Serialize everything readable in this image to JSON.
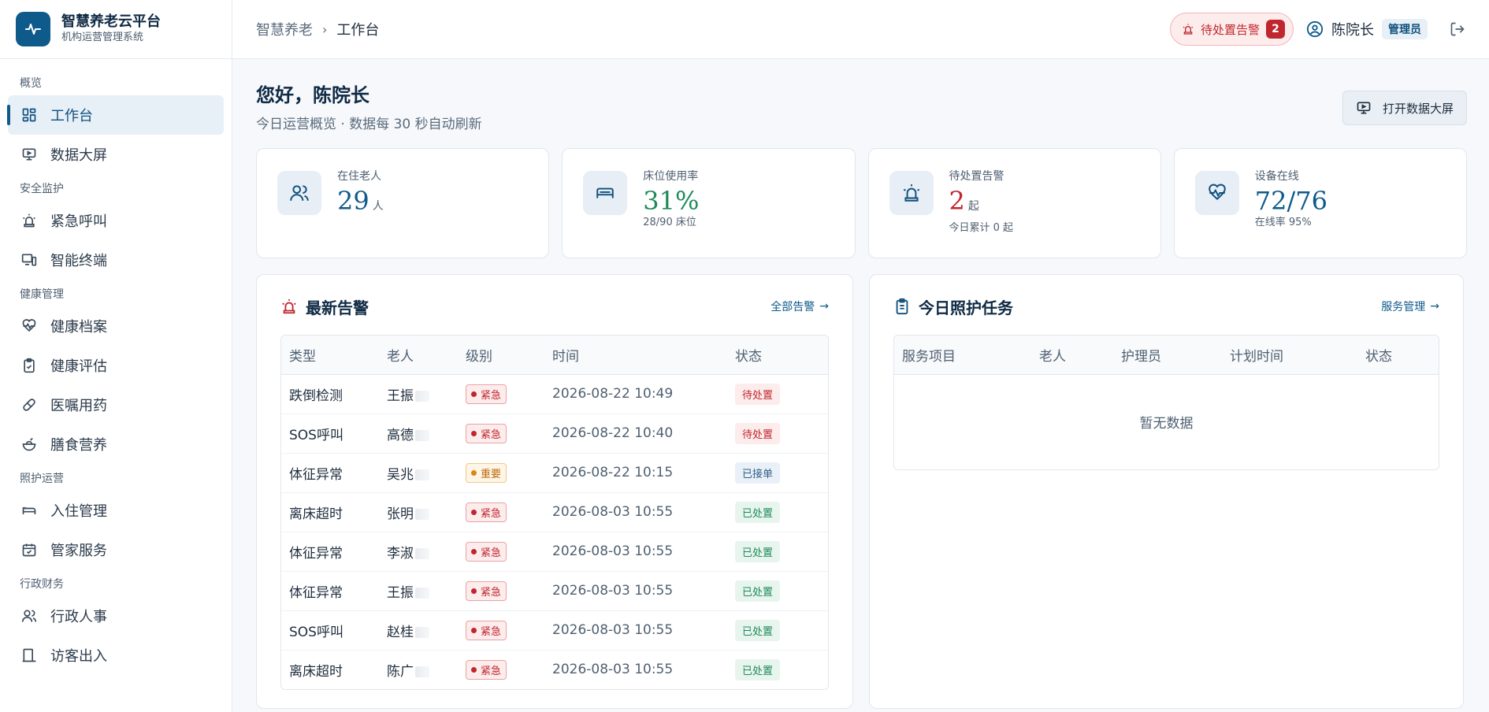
{
  "brand": {
    "title": "智慧养老云平台",
    "subtitle": "机构运营管理系统"
  },
  "sidebar": {
    "groups": [
      {
        "label": "概览",
        "items": [
          {
            "label": "工作台",
            "icon": "dashboard-icon",
            "active": true
          },
          {
            "label": "数据大屏",
            "icon": "monitor-icon"
          }
        ]
      },
      {
        "label": "安全监护",
        "items": [
          {
            "label": "紧急呼叫",
            "icon": "siren-icon"
          },
          {
            "label": "智能终端",
            "icon": "devices-icon"
          }
        ]
      },
      {
        "label": "健康管理",
        "items": [
          {
            "label": "健康档案",
            "icon": "heart-pulse-icon"
          },
          {
            "label": "健康评估",
            "icon": "clipboard-check-icon"
          },
          {
            "label": "医嘱用药",
            "icon": "pill-icon"
          },
          {
            "label": "膳食营养",
            "icon": "salad-icon"
          }
        ]
      },
      {
        "label": "照护运营",
        "items": [
          {
            "label": "入住管理",
            "icon": "bed-icon"
          },
          {
            "label": "管家服务",
            "icon": "calendar-check-icon"
          }
        ]
      },
      {
        "label": "行政财务",
        "items": [
          {
            "label": "行政人事",
            "icon": "users-icon"
          },
          {
            "label": "访客出入",
            "icon": "door-icon"
          }
        ]
      }
    ]
  },
  "header": {
    "breadcrumb": [
      "智慧养老",
      "工作台"
    ],
    "alarm_label": "待处置告警",
    "alarm_count": "2",
    "user_name": "陈院长",
    "user_role": "管理员"
  },
  "welcome": {
    "title": "您好，陈院长",
    "subtitle": "今日运营概览 · 数据每 30 秒自动刷新",
    "open_screen": "打开数据大屏"
  },
  "stats": [
    {
      "label": "在住老人",
      "value": "29",
      "unit": "人",
      "sub": "",
      "icon": "users-icon"
    },
    {
      "label": "床位使用率",
      "value": "31%",
      "unit": "",
      "sub": "28/90 床位",
      "icon": "bed-icon"
    },
    {
      "label": "待处置告警",
      "value": "2",
      "unit": "起",
      "sub": "今日累计 0 起",
      "icon": "siren-icon"
    },
    {
      "label": "设备在线",
      "value": "72/76",
      "unit": "",
      "sub": "在线率 95%",
      "icon": "heart-pulse-icon"
    }
  ],
  "alerts": {
    "title": "最新告警",
    "more": "全部告警",
    "columns": [
      "类型",
      "老人",
      "级别",
      "时间",
      "状态"
    ],
    "rows": [
      {
        "type": "跌倒检测",
        "elder": "王振",
        "level": "紧急",
        "time": "2026-08-22 10:49",
        "status": "待处置"
      },
      {
        "type": "SOS呼叫",
        "elder": "高德",
        "level": "紧急",
        "time": "2026-08-22 10:40",
        "status": "待处置"
      },
      {
        "type": "体征异常",
        "elder": "吴兆",
        "level": "重要",
        "time": "2026-08-22 10:15",
        "status": "已接单"
      },
      {
        "type": "离床超时",
        "elder": "张明",
        "level": "紧急",
        "time": "2026-08-03 10:55",
        "status": "已处置"
      },
      {
        "type": "体征异常",
        "elder": "李淑",
        "level": "紧急",
        "time": "2026-08-03 10:55",
        "status": "已处置"
      },
      {
        "type": "体征异常",
        "elder": "王振",
        "level": "紧急",
        "time": "2026-08-03 10:55",
        "status": "已处置"
      },
      {
        "type": "SOS呼叫",
        "elder": "赵桂",
        "level": "紧急",
        "time": "2026-08-03 10:55",
        "status": "已处置"
      },
      {
        "type": "离床超时",
        "elder": "陈广",
        "level": "紧急",
        "time": "2026-08-03 10:55",
        "status": "已处置"
      }
    ]
  },
  "tasks": {
    "title": "今日照护任务",
    "more": "服务管理",
    "columns": [
      "服务项目",
      "老人",
      "护理员",
      "计划时间",
      "状态"
    ],
    "empty": "暂无数据"
  },
  "colors": {
    "brand": "#0e5a8a",
    "danger": "#c0262d",
    "success": "#1f8a5a",
    "warning": "#d9870f"
  }
}
